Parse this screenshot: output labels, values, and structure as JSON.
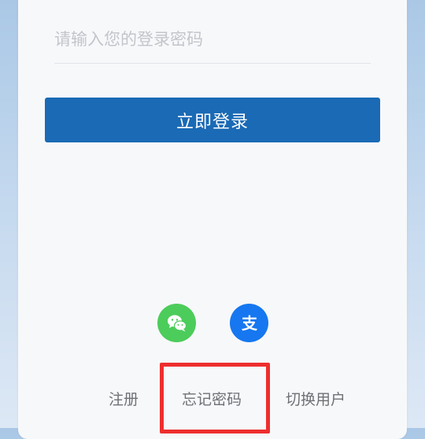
{
  "login_form": {
    "password_placeholder": "请输入您的登录密码",
    "password_value": "",
    "submit_label": "立即登录"
  },
  "social_login": {
    "wechat_icon": "wechat-icon",
    "alipay_icon": "alipay-icon",
    "alipay_glyph": "支"
  },
  "footer_links": {
    "register": "注册",
    "forgot_password": "忘记密码",
    "switch_user": "切换用户"
  },
  "colors": {
    "primary_button": "#1a6ab5",
    "wechat": "#4ccc5b",
    "alipay": "#1677f0",
    "highlight": "#ee2e2e"
  }
}
